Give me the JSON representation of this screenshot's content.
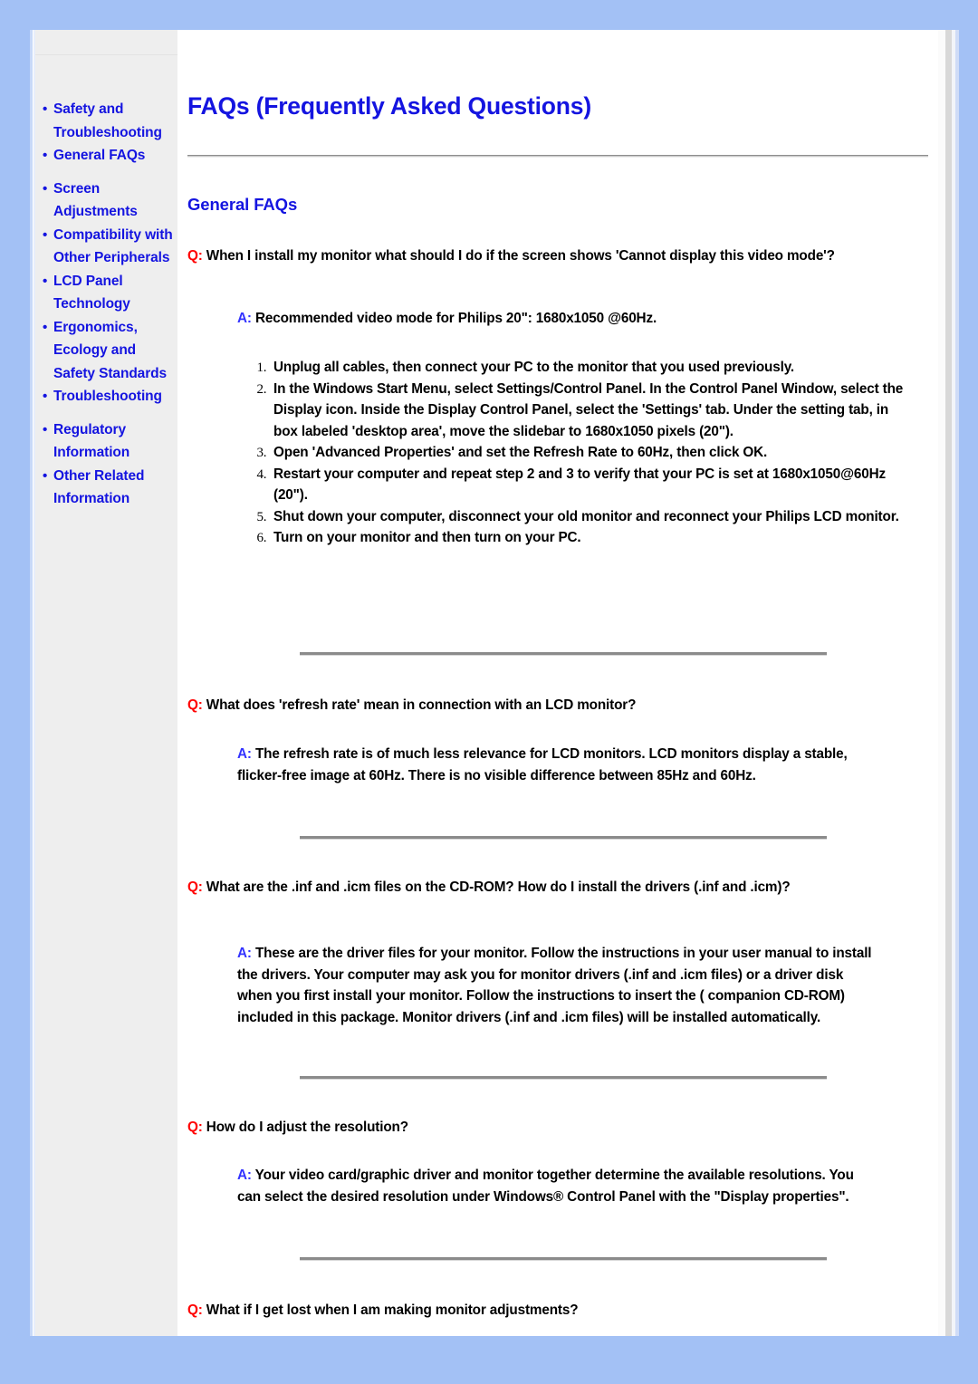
{
  "colors": {
    "page_background": "#a3c1f5",
    "content_background": "#ffffff",
    "sidebar_background": "#eeeeee",
    "link_blue": "#1414e0",
    "question_red": "#ff0000",
    "answer_blue": "#3333ff",
    "rule_gray": "#8b8b8b"
  },
  "sidebar": {
    "bullet_glyph": "•",
    "items": [
      {
        "label": "Safety and Troubleshooting"
      },
      {
        "label": "General FAQs"
      },
      {
        "label": "Screen Adjustments"
      },
      {
        "label": "Compatibility with Other Peripherals"
      },
      {
        "label": "LCD Panel Technology"
      },
      {
        "label": "Ergonomics, Ecology and Safety Standards"
      },
      {
        "label": "Troubleshooting"
      },
      {
        "label": "Regulatory Information"
      },
      {
        "label": "Other Related Information"
      }
    ]
  },
  "main": {
    "page_title": "FAQs (Frequently Asked Questions)",
    "section_heading": "General FAQs",
    "q_prefix": "Q:",
    "a_prefix": "A:",
    "qa": [
      {
        "question": "When I install my monitor what should I do if the screen shows 'Cannot display this video mode'?",
        "answer": "Recommended video mode for Philips 20\": 1680x1050 @60Hz.",
        "steps": [
          "Unplug all cables, then connect your PC to the monitor that you used previously.",
          "In the Windows Start Menu, select Settings/Control Panel. In the Control Panel Window, select the Display icon. Inside the Display Control Panel, select the 'Settings' tab. Under the setting tab, in box labeled 'desktop area', move the slidebar to 1680x1050 pixels (20\").",
          "Open 'Advanced Properties' and set the Refresh Rate to 60Hz, then click OK.",
          "Restart your computer and repeat step 2 and 3 to verify that your PC is set at 1680x1050@60Hz (20\").",
          "Shut down your computer, disconnect your old monitor and reconnect your Philips LCD monitor.",
          "Turn on your monitor and then turn on your PC."
        ]
      },
      {
        "question": "What does 'refresh rate' mean in connection with an LCD monitor?",
        "answer": "The refresh rate is of much less relevance for LCD monitors. LCD monitors display a stable, flicker-free image at 60Hz. There is no visible difference between 85Hz and 60Hz."
      },
      {
        "question": "What are the .inf and .icm files on the CD-ROM? How do I install the drivers (.inf and .icm)?",
        "answer": "These are the driver files for your monitor. Follow the instructions in your user manual to install the drivers. Your computer may ask you for monitor drivers (.inf and .icm files) or a driver disk when you first install your monitor. Follow the instructions to insert the ( companion CD-ROM) included in this package. Monitor drivers (.inf and .icm files) will be installed automatically."
      },
      {
        "question": "How do I adjust the resolution?",
        "answer": "Your video card/graphic driver and monitor together determine the available resolutions. You can select the desired resolution under Windows® Control Panel with the \"Display properties\"."
      },
      {
        "question": "What if I get lost when I am making monitor adjustments?"
      }
    ]
  }
}
